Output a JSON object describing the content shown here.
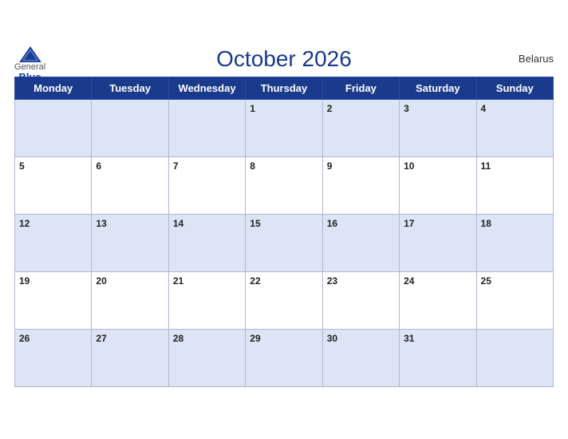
{
  "header": {
    "logo_general": "General",
    "logo_blue": "Blue",
    "title": "October 2026",
    "country": "Belarus"
  },
  "weekdays": [
    "Monday",
    "Tuesday",
    "Wednesday",
    "Thursday",
    "Friday",
    "Saturday",
    "Sunday"
  ],
  "weeks": [
    [
      "",
      "",
      "",
      "1",
      "2",
      "3",
      "4"
    ],
    [
      "5",
      "6",
      "7",
      "8",
      "9",
      "10",
      "11"
    ],
    [
      "12",
      "13",
      "14",
      "15",
      "16",
      "17",
      "18"
    ],
    [
      "19",
      "20",
      "21",
      "22",
      "23",
      "24",
      "25"
    ],
    [
      "26",
      "27",
      "28",
      "29",
      "30",
      "31",
      ""
    ]
  ],
  "colors": {
    "header_bg": "#1a3a8c",
    "row_odd": "#dce4f5",
    "row_even": "#ffffff",
    "border": "#b0b8d0",
    "title": "#1a3a8c"
  }
}
